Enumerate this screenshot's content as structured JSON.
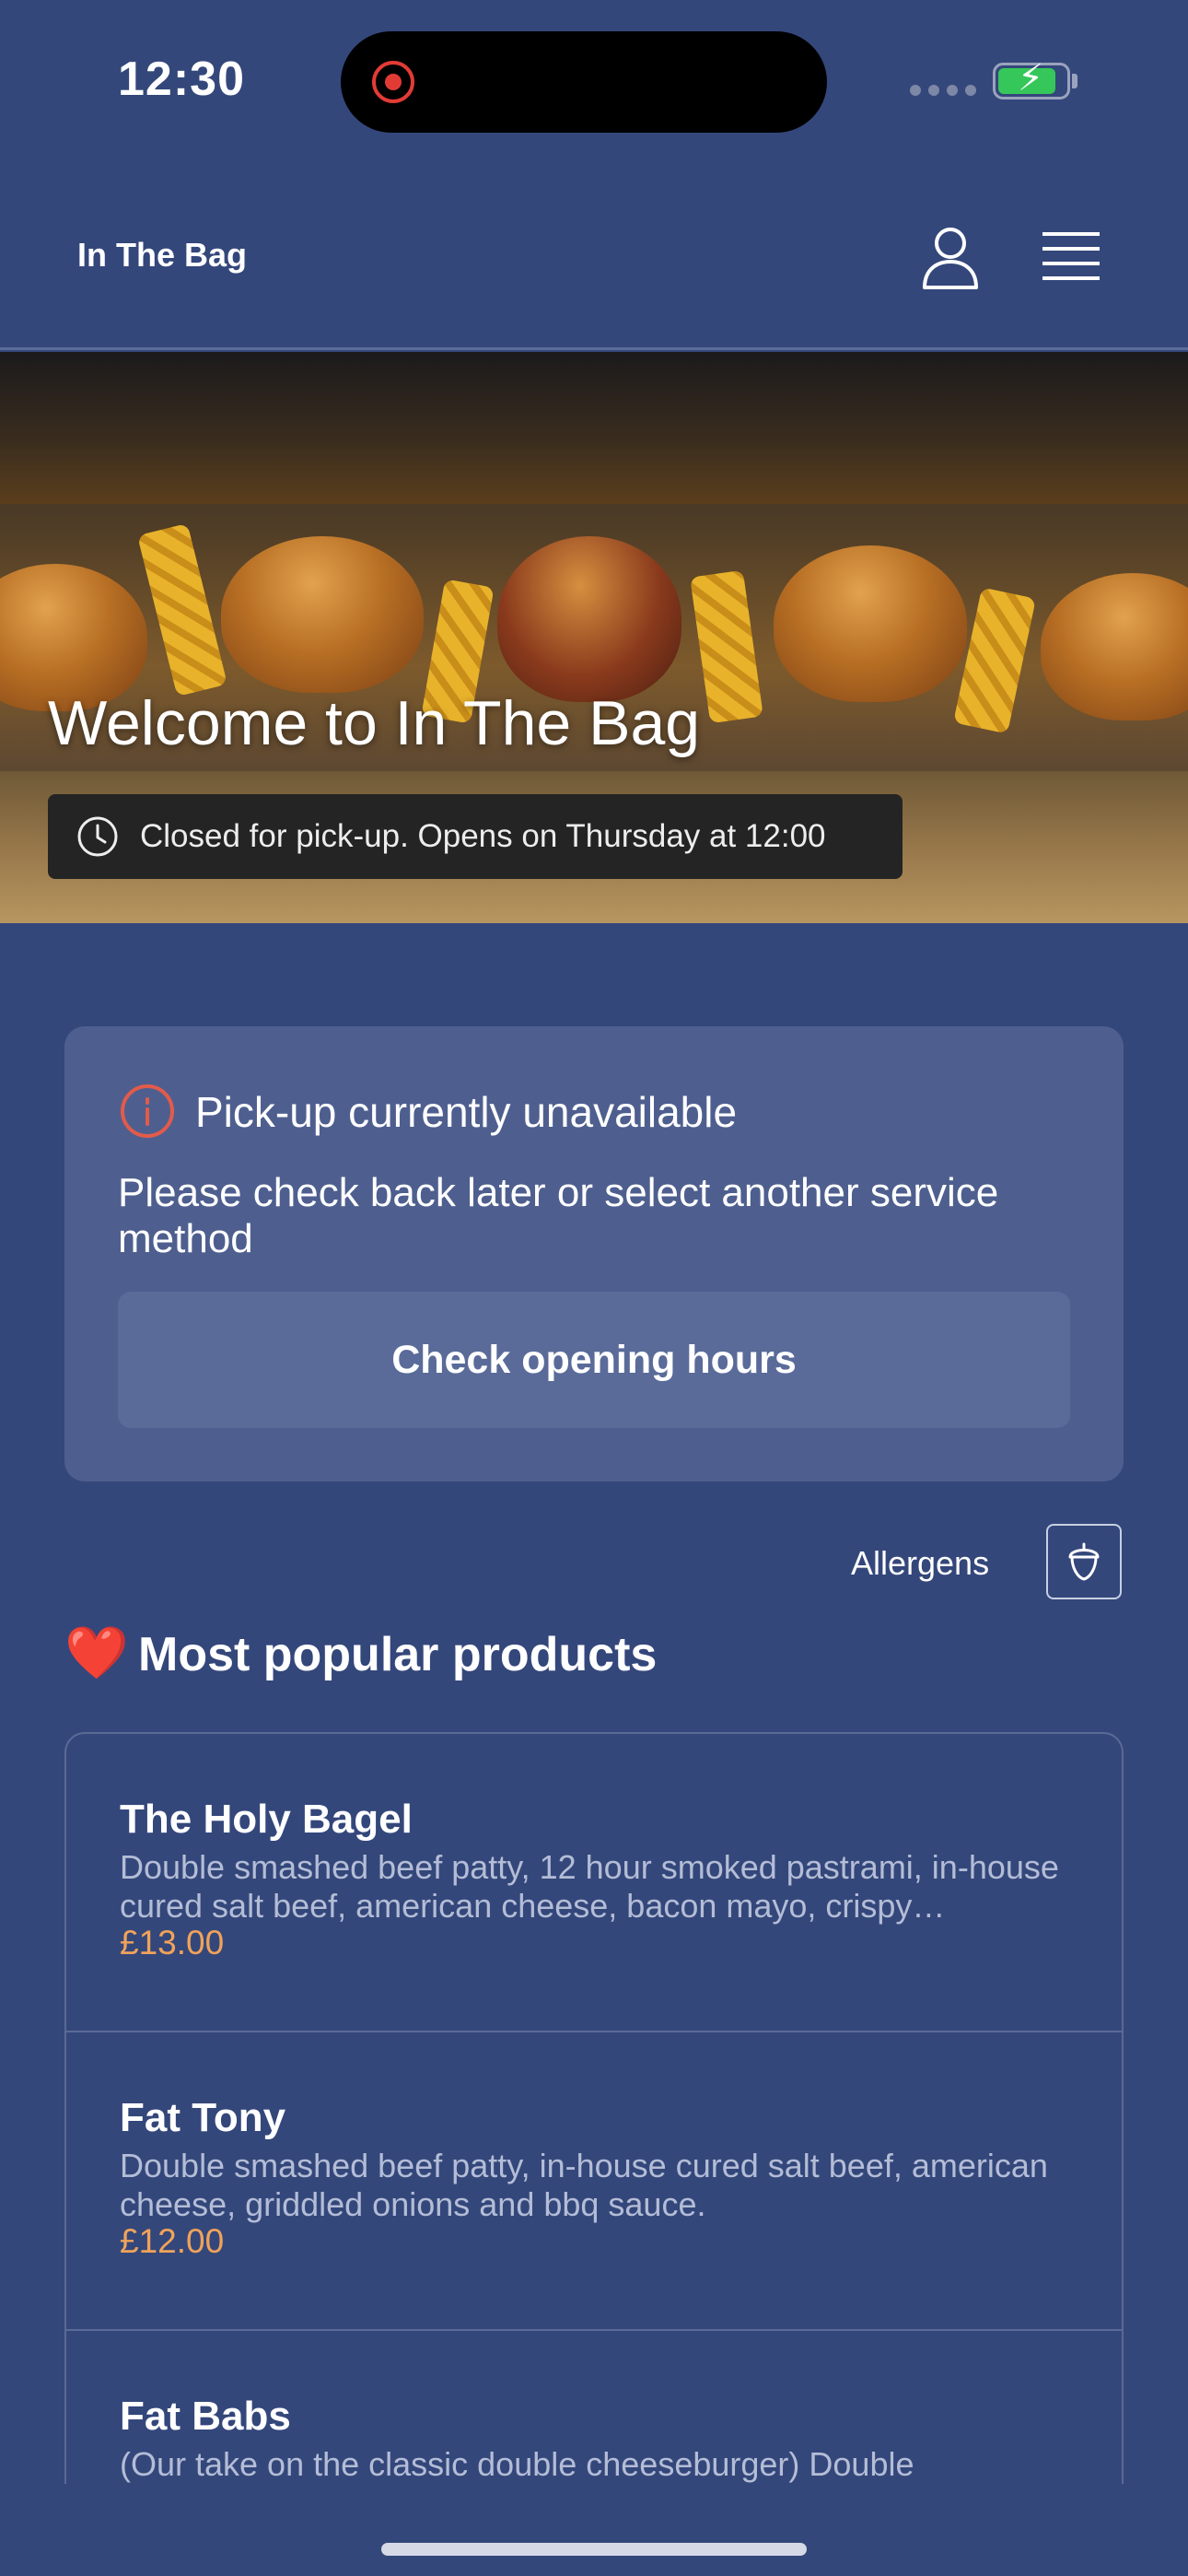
{
  "status_bar": {
    "time": "12:30",
    "icons": [
      "recording-icon",
      "signal-icon",
      "battery-charging-icon"
    ]
  },
  "header": {
    "brand": "In The Bag",
    "icons": [
      "user-icon",
      "menu-icon"
    ]
  },
  "hero": {
    "title": "Welcome to In The Bag",
    "status_text": "Closed for pick-up. Opens on Thursday at 12:00",
    "status_icon": "clock-icon"
  },
  "notice": {
    "icon": "info-icon",
    "icon_color": "#e25b4a",
    "title": "Pick-up currently unavailable",
    "body": "Please check back later or select another service method",
    "button_label": "Check opening hours"
  },
  "allergens": {
    "label": "Allergens",
    "icon": "acorn-icon"
  },
  "popular": {
    "emoji": "❤️",
    "title": "Most popular products"
  },
  "products": [
    {
      "name": "The Holy Bagel",
      "description": "Double smashed beef patty, 12 hour smoked pastrami, in-house cured salt beef, american cheese, bacon mayo, crispy…",
      "price": "£13.00"
    },
    {
      "name": "Fat Tony",
      "description": "Double smashed beef patty, in-house cured salt beef, american cheese, griddled onions and bbq sauce.",
      "price": "£12.00"
    },
    {
      "name": "Fat Babs",
      "description": "(Our take on the classic double cheeseburger) Double"
    }
  ],
  "colors": {
    "background": "#34477b",
    "card": "#4e5f8f",
    "price": "#f0a35a"
  }
}
